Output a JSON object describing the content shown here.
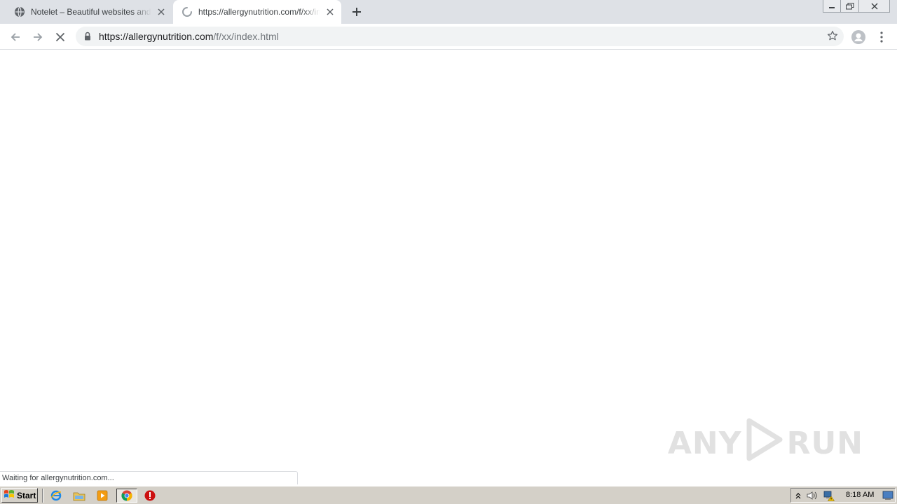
{
  "tabs": [
    {
      "title": "Notelet – Beautiful websites and blogs",
      "state": "inactive",
      "favicon": "globe-icon"
    },
    {
      "title": "https://allergynutrition.com/f/xx/index.html",
      "state": "active-loading",
      "favicon": "loading-spinner-icon"
    }
  ],
  "toolbar": {
    "url_host": "https://allergynutrition.com",
    "url_path": "/f/xx/index.html"
  },
  "status": {
    "text": "Waiting for allergynutrition.com..."
  },
  "watermark": {
    "left": "ANY",
    "right": "RUN"
  },
  "taskbar": {
    "start_label": "Start",
    "clock": "8:18 AM",
    "quick_launch": [
      "internet-explorer-icon",
      "folder-icon",
      "media-player-icon",
      "chrome-icon",
      "stop-sign-icon"
    ]
  },
  "colors": {
    "tabstrip": "#dee1e6",
    "omnibox": "#f1f3f4",
    "taskbar": "#d4d0c8"
  }
}
